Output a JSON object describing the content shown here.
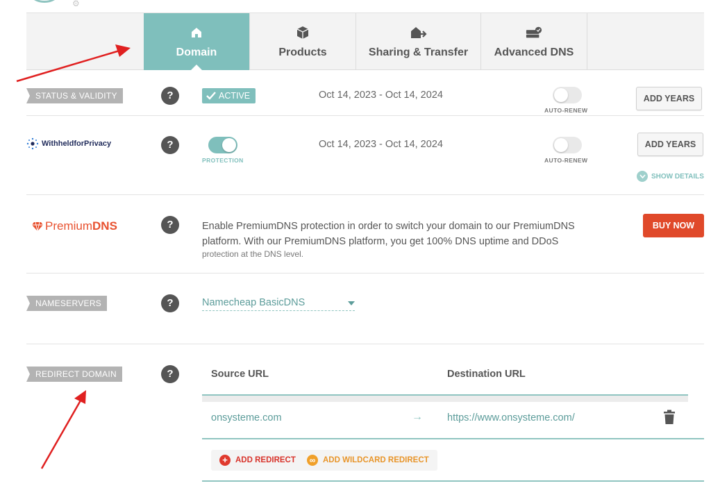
{
  "tabs": [
    {
      "label": "Domain",
      "icon": "home-icon",
      "active": true
    },
    {
      "label": "Products",
      "icon": "box-icon",
      "active": false
    },
    {
      "label": "Sharing & Transfer",
      "icon": "transfer-icon",
      "active": false
    },
    {
      "label": "Advanced DNS",
      "icon": "server-icon",
      "active": false
    }
  ],
  "status": {
    "label": "STATUS & VALIDITY",
    "help": "?",
    "badge": "ACTIVE",
    "dates": "Oct 14, 2023 - Oct 14, 2024",
    "auto_renew_label": "AUTO-RENEW",
    "auto_renew_on": false,
    "button": "ADD YEARS"
  },
  "privacy": {
    "logo_bold": "Withheld",
    "logo_rest": "forPrivacy",
    "help": "?",
    "protection_label": "PROTECTION",
    "protection_on": true,
    "dates": "Oct 14, 2023 - Oct 14, 2024",
    "auto_renew_label": "AUTO-RENEW",
    "auto_renew_on": false,
    "button": "ADD YEARS",
    "show_details": "SHOW DETAILS"
  },
  "premium": {
    "logo_prefix": "Premium",
    "logo_bold": "DNS",
    "help": "?",
    "description": "Enable PremiumDNS protection in order to switch your domain to our PremiumDNS platform. With our PremiumDNS platform, you get 100% DNS uptime and DDoS",
    "description_faded": "protection at the DNS level.",
    "button": "BUY NOW"
  },
  "nameservers": {
    "label": "NAMESERVERS",
    "help": "?",
    "selected": "Namecheap BasicDNS"
  },
  "redirect": {
    "label": "REDIRECT DOMAIN",
    "help": "?",
    "source_header": "Source URL",
    "destination_header": "Destination URL",
    "rows": [
      {
        "source": "onsystemе.com",
        "arrow": "→",
        "destination": "https://www.onsysteme.com/"
      }
    ],
    "add_redirect": "ADD REDIRECT",
    "add_wildcard": "ADD WILDCARD REDIRECT"
  },
  "colors": {
    "teal": "#7fbfbc",
    "red": "#e0492a",
    "orange": "#e8952a",
    "annotation_arrow": "#e02020"
  }
}
